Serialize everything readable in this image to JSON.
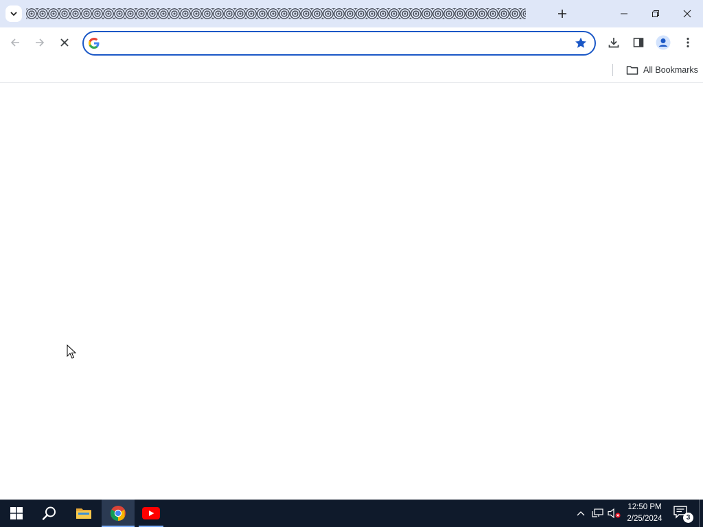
{
  "browser": {
    "omnibox": {
      "value": "",
      "placeholder": ""
    },
    "bookmarks_bar": {
      "all_bookmarks_label": "All Bookmarks"
    },
    "icons": {
      "tab_search": "chevron-down-icon",
      "new_tab": "plus-icon",
      "minimize": "minimize-icon",
      "restore": "restore-icon",
      "close": "close-icon",
      "back": "arrow-left-icon",
      "forward": "arrow-right-icon",
      "stop": "close-icon",
      "search_engine": "google-g-icon",
      "bookmark": "star-icon",
      "download": "download-icon",
      "side_panel": "side-panel-icon",
      "profile": "person-icon",
      "menu": "kebab-menu-icon",
      "bookmarks_folder": "folder-icon"
    },
    "colors": {
      "titlebar": "#dfe7f8",
      "omnibox_focus": "#1a57c6",
      "bookmark_star": "#1a57c6"
    }
  },
  "taskbar": {
    "apps": [
      "Start",
      "Search",
      "File Explorer",
      "Google Chrome",
      "YouTube"
    ],
    "clock": {
      "time": "12:50 PM",
      "date": "2/25/2024"
    },
    "notifications_count": "3",
    "colors": {
      "background": "#0f1a2b"
    }
  }
}
